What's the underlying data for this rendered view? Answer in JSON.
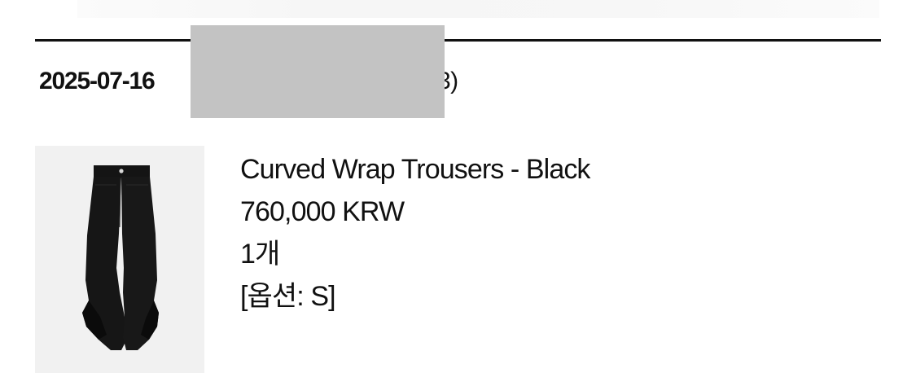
{
  "order": {
    "date": "2025-07-16",
    "number_visible_fragment": "3)"
  },
  "product": {
    "image_icon": "trousers-image",
    "name": "Curved Wrap Trousers - Black",
    "price": "760,000 KRW",
    "quantity": "1개",
    "option": "[옵션: S]"
  },
  "colors": {
    "text": "#111111",
    "divider": "#111111",
    "redaction": "#c3c3c3",
    "thumbnail_bg": "#f1f1f1"
  }
}
